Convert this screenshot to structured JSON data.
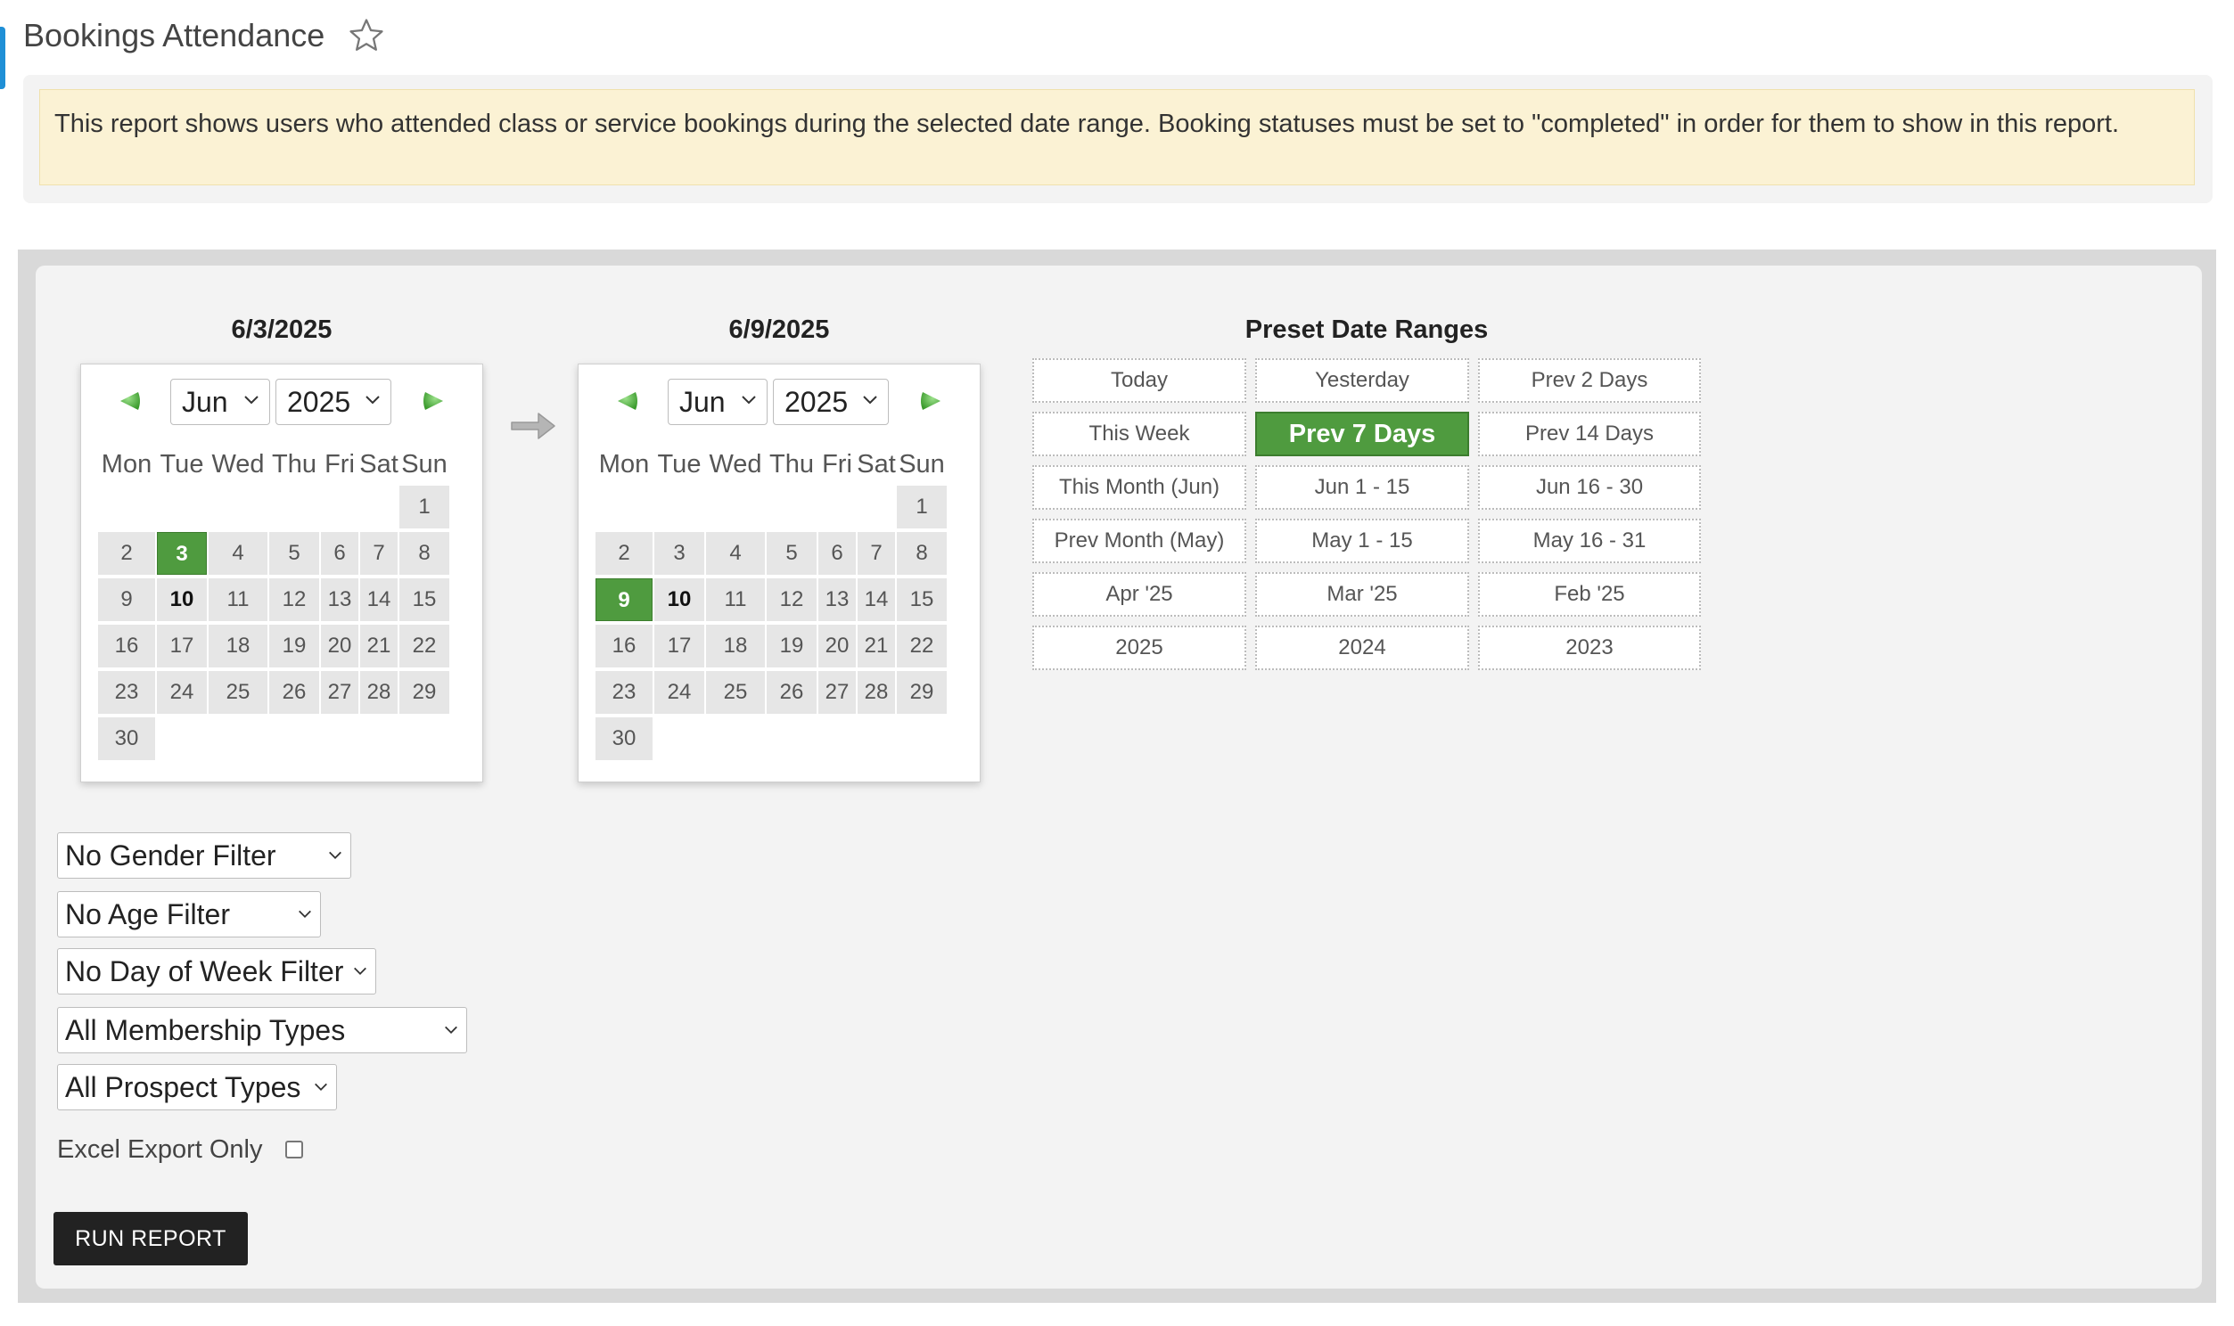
{
  "page": {
    "title": "Bookings Attendance",
    "favorite_icon": "star-icon"
  },
  "notice": {
    "text": "This report shows users who attended class or service bookings during the selected date range. Booking statuses must be set to \"completed\" in order for them to show in this report."
  },
  "start_calendar": {
    "date_label": "6/3/2025",
    "month": "Jun",
    "year": "2025",
    "prev_icon": "prev-arrow-icon",
    "next_icon": "next-arrow-icon",
    "weekdays": [
      "Mon",
      "Tue",
      "Wed",
      "Thu",
      "Fri",
      "Sat",
      "Sun"
    ],
    "weeks": [
      [
        "",
        "",
        "",
        "",
        "",
        "",
        "1"
      ],
      [
        "2",
        "3",
        "4",
        "5",
        "6",
        "7",
        "8"
      ],
      [
        "9",
        "10",
        "11",
        "12",
        "13",
        "14",
        "15"
      ],
      [
        "16",
        "17",
        "18",
        "19",
        "20",
        "21",
        "22"
      ],
      [
        "23",
        "24",
        "25",
        "26",
        "27",
        "28",
        "29"
      ],
      [
        "30",
        "",
        "",
        "",
        "",
        "",
        ""
      ]
    ],
    "selected_day": "3",
    "today_day": "10"
  },
  "end_calendar": {
    "date_label": "6/9/2025",
    "month": "Jun",
    "year": "2025",
    "prev_icon": "prev-arrow-icon",
    "next_icon": "next-arrow-icon",
    "weekdays": [
      "Mon",
      "Tue",
      "Wed",
      "Thu",
      "Fri",
      "Sat",
      "Sun"
    ],
    "weeks": [
      [
        "",
        "",
        "",
        "",
        "",
        "",
        "1"
      ],
      [
        "2",
        "3",
        "4",
        "5",
        "6",
        "7",
        "8"
      ],
      [
        "9",
        "10",
        "11",
        "12",
        "13",
        "14",
        "15"
      ],
      [
        "16",
        "17",
        "18",
        "19",
        "20",
        "21",
        "22"
      ],
      [
        "23",
        "24",
        "25",
        "26",
        "27",
        "28",
        "29"
      ],
      [
        "30",
        "",
        "",
        "",
        "",
        "",
        ""
      ]
    ],
    "selected_day": "9",
    "today_day": "10"
  },
  "range_arrow_icon": "right-arrow-icon",
  "presets": {
    "title": "Preset Date Ranges",
    "rows": [
      [
        "Today",
        "Yesterday",
        "Prev 2 Days"
      ],
      [
        "This Week",
        "Prev 7 Days",
        "Prev 14 Days"
      ],
      [
        "This Month (Jun)",
        "Jun 1 - 15",
        "Jun 16 - 30"
      ],
      [
        "Prev Month (May)",
        "May 1 - 15",
        "May 16 - 31"
      ],
      [
        "Apr '25",
        "Mar '25",
        "Feb '25"
      ],
      [
        "2025",
        "2024",
        "2023"
      ]
    ],
    "active": "Prev 7 Days"
  },
  "filters": {
    "gender": "No Gender Filter",
    "age": "No Age Filter",
    "day_of_week": "No Day of Week Filter",
    "membership": "All Membership Types",
    "prospect": "All Prospect Types"
  },
  "export": {
    "label": "Excel Export Only",
    "checked": false
  },
  "run_button": {
    "label": "RUN REPORT"
  },
  "colors": {
    "accent_green": "#4f9b3f",
    "notice_bg": "#fbf2d4",
    "button_dark": "#222222"
  }
}
